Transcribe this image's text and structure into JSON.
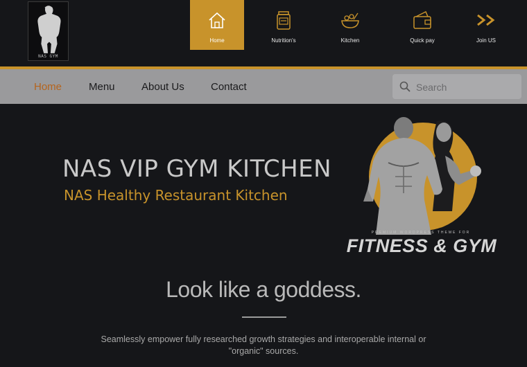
{
  "header": {
    "logo_text": "NAS GYM",
    "nav_icons": [
      {
        "label": "Home",
        "icon": "house-icon",
        "active": true
      },
      {
        "label": "Nutrition's",
        "icon": "nutrition-jar-icon",
        "active": false
      },
      {
        "label": "Kitchen",
        "icon": "bowl-icon",
        "active": false
      },
      {
        "label": "Quick pay",
        "icon": "wallet-icon",
        "active": false
      },
      {
        "label": "Join US",
        "icon": "double-chevron-icon",
        "active": false
      }
    ]
  },
  "menu": {
    "items": [
      {
        "label": "Home",
        "active": true
      },
      {
        "label": "Menu",
        "active": false
      },
      {
        "label": "About Us",
        "active": false
      },
      {
        "label": "Contact",
        "active": false
      }
    ],
    "search_placeholder": "Search"
  },
  "hero": {
    "title": "NAS VIP GYM KITCHEN",
    "subtitle": "NAS Healthy Restaurant Kitchen",
    "image_caption_small": "PREMIUM WORDPRESS THEME FOR",
    "image_caption_big": "FITNESS & GYM"
  },
  "content": {
    "tagline": "Look like a goddess.",
    "body": "Seamlessly empower fully researched growth strategies and interoperable internal or \"organic\" sources."
  },
  "colors": {
    "accent": "#c8932b",
    "background": "#151619",
    "menubar": "#9a9a9c",
    "active_menu_text": "#b5641d"
  }
}
